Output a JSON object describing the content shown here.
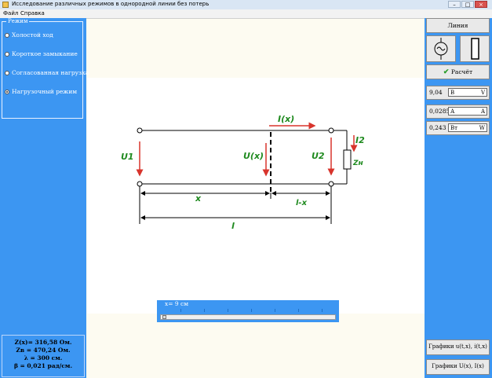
{
  "window": {
    "title": "Исследование различных режимов в однородной линии без потерь",
    "buttons": [
      "–",
      "□",
      "×"
    ]
  },
  "menu": {
    "items": [
      "Файл",
      "Справка"
    ]
  },
  "modes": {
    "legend": "Режим",
    "items": [
      {
        "label": "Холостой ход",
        "selected": false
      },
      {
        "label": "Короткое замыкание",
        "selected": false
      },
      {
        "label": "Согласованная нагрузка",
        "selected": false
      },
      {
        "label": "Нагрузочный режим",
        "selected": true
      }
    ]
  },
  "params": {
    "zx": "Z(x)= 316,58 Ом.",
    "zv": "Zв = 470,24 Ом.",
    "lambda": "λ = 300 см.",
    "beta": "β = 0,021 рад/см."
  },
  "right": {
    "line_button": "Линия",
    "source_icon": "ac-source-icon",
    "load_icon": "resistor-icon",
    "calc_button": "Расчёт",
    "calc_icon": "checkmark-icon",
    "values": [
      {
        "num": "9,04",
        "unit_left": "В",
        "unit_right": "V"
      },
      {
        "num": "0,0285",
        "unit_left": "А",
        "unit_right": "A"
      },
      {
        "num": "0,243",
        "unit_left": "Вт",
        "unit_right": "W"
      }
    ],
    "graph_button_1": "Графики u(t,x), i(t,x)",
    "graph_button_2": "Графики U(x), I(x)"
  },
  "slider": {
    "label": "x= 9 см",
    "value_cm": 9
  },
  "diagram": {
    "u1": "U1",
    "ux": "U(x)",
    "u2": "U2",
    "ix": "I(x)",
    "i2": "I2",
    "zn": "Zн",
    "x": "x",
    "lx": "l-x",
    "l": "l",
    "colors": {
      "red": "#d8342c",
      "green": "#1f8a1f",
      "line": "#000000"
    }
  }
}
